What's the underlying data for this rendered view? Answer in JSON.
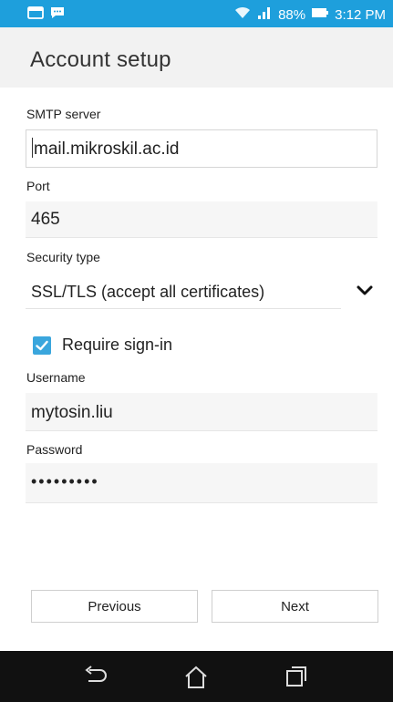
{
  "status_bar": {
    "battery": "88%",
    "time": "3:12 PM",
    "icons": [
      "notification-app-icon",
      "chat-message-icon",
      "wifi-icon",
      "signal-icon",
      "battery-icon"
    ]
  },
  "header": {
    "title": "Account setup"
  },
  "form": {
    "smtp_server": {
      "label": "SMTP server",
      "value": "mail.mikroskil.ac.id"
    },
    "port": {
      "label": "Port",
      "value": "465"
    },
    "security_type": {
      "label": "Security type",
      "value": "SSL/TLS (accept all certificates)"
    },
    "require_signin": {
      "label": "Require sign-in",
      "checked": true
    },
    "username": {
      "label": "Username",
      "value": "mytosin.liu"
    },
    "password": {
      "label": "Password",
      "value": "•••••••••"
    }
  },
  "buttons": {
    "previous": "Previous",
    "next": "Next"
  },
  "nav_bar": {
    "icons": [
      "back-icon",
      "home-icon",
      "recents-icon"
    ]
  },
  "colors": {
    "status_bar": "#1e9fdc",
    "accent": "#3aa6dd",
    "nav_bar": "#111111"
  }
}
